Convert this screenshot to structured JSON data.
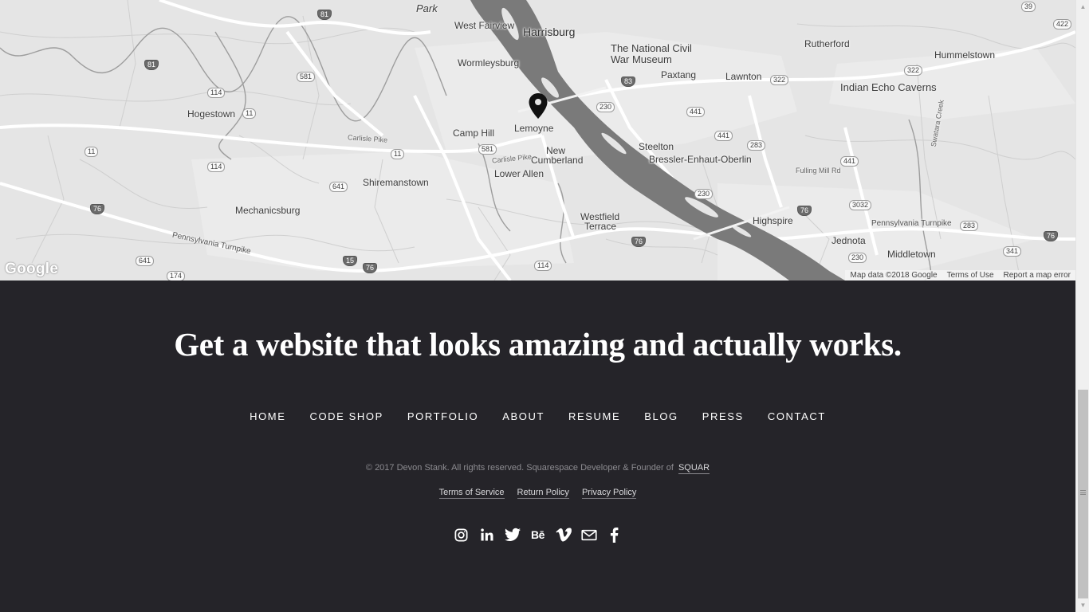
{
  "map": {
    "places": [
      {
        "name": "Harrisburg",
        "size": "lg"
      },
      {
        "name": "West Fairview",
        "size": "sm"
      },
      {
        "name": "Wormleysburg",
        "size": "sm"
      },
      {
        "name": "Park",
        "size": "md"
      },
      {
        "name": "The National Civil",
        "size": "md"
      },
      {
        "name": "War Museum",
        "size": "md"
      },
      {
        "name": "Rutherford",
        "size": "sm"
      },
      {
        "name": "Hummelstown",
        "size": "sm"
      },
      {
        "name": "Indian Echo Caverns",
        "size": "md"
      },
      {
        "name": "Paxtang",
        "size": "sm"
      },
      {
        "name": "Lawnton",
        "size": "sm"
      },
      {
        "name": "Hogestown",
        "size": "sm"
      },
      {
        "name": "Camp Hill",
        "size": "sm"
      },
      {
        "name": "Lemoyne",
        "size": "sm"
      },
      {
        "name": "New",
        "size": "sm"
      },
      {
        "name": "Cumberland",
        "size": "sm"
      },
      {
        "name": "Steelton",
        "size": "sm"
      },
      {
        "name": "Bressler-Enhaut-Oberlin",
        "size": "sm"
      },
      {
        "name": "Lower Allen",
        "size": "sm"
      },
      {
        "name": "Shiremanstown",
        "size": "sm"
      },
      {
        "name": "Mechanicsburg",
        "size": "sm"
      },
      {
        "name": "Westfield",
        "size": "sm"
      },
      {
        "name": "Terrace",
        "size": "sm"
      },
      {
        "name": "Highspire",
        "size": "sm"
      },
      {
        "name": "Jednota",
        "size": "sm"
      },
      {
        "name": "Middletown",
        "size": "sm"
      }
    ],
    "road_labels": [
      "Pennsylvania Turnpike",
      "Pennsylvania Turnpike",
      "Carlisle Pike",
      "Carlisle Pike",
      "Fulling Mill Rd",
      "Swatara Creek"
    ],
    "shields": [
      "81",
      "81",
      "581",
      "114",
      "11",
      "11",
      "114",
      "641",
      "76",
      "641",
      "174",
      "15",
      "76",
      "581",
      "11",
      "83",
      "230",
      "441",
      "441",
      "283",
      "322",
      "322",
      "422",
      "39",
      "441",
      "3032",
      "283",
      "76",
      "230",
      "341",
      "76",
      "230",
      "76",
      "114"
    ],
    "google_logo": "Google",
    "attribution": "Map data ©2018 Google",
    "terms": "Terms of Use",
    "report": "Report a map error"
  },
  "footer": {
    "tagline": "Get a website that looks amazing and actually works.",
    "nav": [
      "HOME",
      "CODE SHOP",
      "PORTFOLIO",
      "ABOUT",
      "RESUME",
      "BLOG",
      "PRESS",
      "CONTACT"
    ],
    "copyright": "© 2017 Devon Stank. All rights reserved. Squarespace Developer & Founder of",
    "brand": "SQUAR",
    "policies": [
      "Terms of Service",
      "Return Policy",
      "Privacy Policy"
    ],
    "social": [
      "instagram-icon",
      "linkedin-icon",
      "twitter-icon",
      "behance-icon",
      "vimeo-icon",
      "email-icon",
      "facebook-icon"
    ],
    "behance_label": "Bē"
  }
}
